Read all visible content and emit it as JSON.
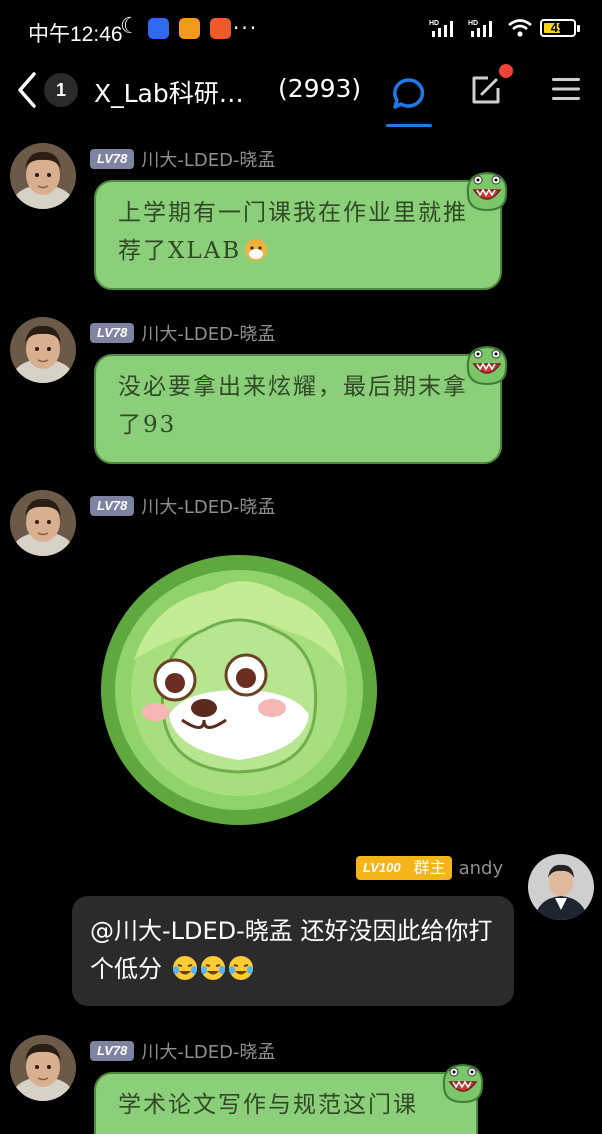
{
  "status_bar": {
    "time": "中午12:46",
    "moon": "☾",
    "more": "···",
    "battery": "49",
    "signal_labels": [
      "HD",
      "HD"
    ]
  },
  "header": {
    "unread_count": "1",
    "title": "X_Lab科研…",
    "member_count": "(2993)",
    "accent_color": "#1e7ae6"
  },
  "messages": [
    {
      "sender": "川大-LDED-晓孟",
      "level": "LV78",
      "text": "上学期有一门课我在作业里就推荐了XLAB",
      "type": "text"
    },
    {
      "sender": "川大-LDED-晓孟",
      "level": "LV78",
      "text": "没必要拿出来炫耀，最后期末拿了93",
      "type": "text"
    },
    {
      "sender": "川大-LDED-晓孟",
      "level": "LV78",
      "type": "sticker",
      "sticker": "cabbage-dog-sticker"
    },
    {
      "sender": "andy",
      "level": "LV100",
      "role": "群主",
      "text": "@川大-LDED-晓孟 还好没因此给你打个低分",
      "type": "text",
      "emojis": 3
    },
    {
      "sender": "川大-LDED-晓孟",
      "level": "LV78",
      "text": "学术论文写作与规范这门课",
      "type": "text"
    }
  ]
}
